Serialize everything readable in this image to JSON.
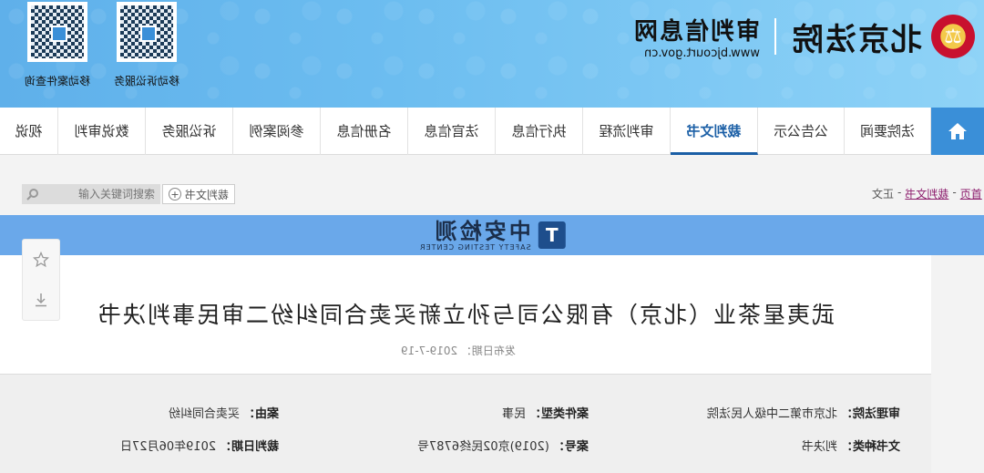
{
  "header": {
    "qr_codes": [
      {
        "label": "移动案件查询"
      },
      {
        "label": "移动诉讼服务"
      }
    ],
    "court_name": "北京法院",
    "site_name": "审判信息网",
    "site_url": "www.bjcourt.gov.cn",
    "emblem_icon": "court-emblem-icon"
  },
  "nav": {
    "home_icon": "home-icon",
    "items": [
      {
        "label": "法院要闻"
      },
      {
        "label": "公告公示"
      },
      {
        "label": "裁判文书",
        "active": true
      },
      {
        "label": "审判流程"
      },
      {
        "label": "执行信息"
      },
      {
        "label": "法官信息"
      },
      {
        "label": "名册信息"
      },
      {
        "label": "参阅案例"
      },
      {
        "label": "诉讼服务"
      },
      {
        "label": "数说审判"
      },
      {
        "label": "视说"
      }
    ]
  },
  "toolbar": {
    "search_placeholder": "输入关键词搜索",
    "filter_label": "裁判文书",
    "breadcrumb": {
      "home": "首页",
      "section": "裁判文书",
      "current": "正文"
    }
  },
  "banner": {
    "logo_char": "T",
    "name_cn": "中安检测",
    "name_en": "SAFETY TESTING CENTER"
  },
  "document": {
    "title": "武夷星茶业（北京）有限公司与孙立新买卖合同纠纷二审民事判决书",
    "publish_date": "发布日期： 2019-7-19",
    "meta": {
      "court_label": "审理法院：",
      "court_value": "北京市第二中级人民法院",
      "case_type_label": "案件类型：",
      "case_type_value": "民事",
      "cause_label": "案由：",
      "cause_value": "买卖合同纠纷",
      "doc_type_label": "文书种类：",
      "doc_type_value": "判决书",
      "case_no_label": "案号：",
      "case_no_value": "(2019)京02民终6787号",
      "judge_date_label": "裁判日期：",
      "judge_date_value": "2019年06月27日"
    }
  },
  "colors": {
    "header_blue": "#6cbdf0",
    "nav_active": "#1b5fa6",
    "home_bg": "#3a8fd8",
    "banner_bg": "#6aa8ea"
  }
}
